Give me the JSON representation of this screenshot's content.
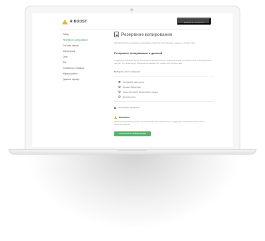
{
  "header": {
    "logo_text": "R·BOOST",
    "action_button": "ВОЙТИ В КАБИНЕТ"
  },
  "sidebar": {
    "items": [
      {
        "label": "Обзор",
        "active": false
      },
      {
        "label": "Резервное копирование",
        "active": true
      },
      {
        "label": "Учётная запись",
        "active": false
      },
      {
        "label": "Мониторинг",
        "active": false
      },
      {
        "label": "Сеть",
        "active": false
      },
      {
        "label": "SSL",
        "active": false
      },
      {
        "label": "Снапшоты и образы",
        "active": false
      },
      {
        "label": "Журнал работ",
        "active": false
      },
      {
        "label": "Удалить сервер",
        "active": false
      }
    ]
  },
  "main": {
    "title": "Резервное копирование",
    "lead": "Автоматическое резервное копирование позволяет восстановить данные в случае сбоя.",
    "section_title": "Резервное копирование в данный",
    "paragraph": "Создание резервной копии выполняется автоматически. Хранение копий производится в отдельном дата-центре, что гарантирует сохранность данных при любых обстоятельствах.",
    "subhead": "Выберите место хранения",
    "options": [
      {
        "label": "Московский дата-центр",
        "checked": true
      },
      {
        "label": "Москва, Лефортово",
        "checked": false
      },
      {
        "label": "Санкт-Петербург, Выборгская сторона",
        "checked": false
      },
      {
        "label": "Другой регион",
        "checked": false
      }
    ],
    "checkbox_label": "Копировать ежедневно",
    "warning_title": "Внимание",
    "warning_text": "Для восстановления данных из резервной копии обратитесь в поддержку. Операция может занять некоторое время.",
    "submit_button": "СОХРАНИТЬ ИЗМЕНЕНИЯ"
  }
}
